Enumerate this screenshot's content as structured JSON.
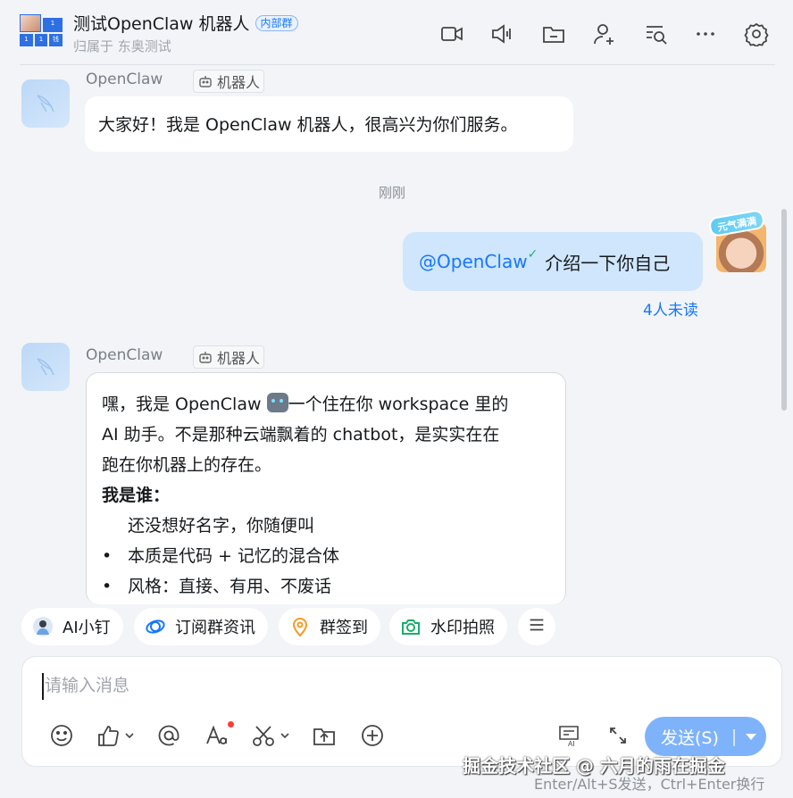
{
  "header": {
    "title": "测试OpenClaw 机器人",
    "tag": "内部群",
    "subtitle": "归属于 东奥测试",
    "avatar_cells": [
      "1",
      "1",
      "1",
      "钱"
    ],
    "icons": [
      "video-icon",
      "voice-icon",
      "folder-icon",
      "add-member-icon",
      "search-history-icon",
      "more-icon",
      "settings-icon"
    ]
  },
  "messages": {
    "first": {
      "sender": "OpenClaw",
      "badge": "机器人",
      "text": "大家好！我是 OpenClaw 机器人，很高兴为你们服务。"
    },
    "timestamp": "刚刚",
    "outgoing": {
      "mention": "@OpenClaw",
      "text": "介绍一下你自己",
      "avatar_frame": "元气满满",
      "unread": "4人未读"
    },
    "second": {
      "sender": "OpenClaw",
      "badge": "机器人",
      "line1_a": "嘿，我是 OpenClaw ",
      "line1_b": "一个住在你 workspace 里的",
      "line2": "AI 助手。不是那种云端飘着的 chatbot，是实实在在",
      "line3": "跑在你机器上的存在。",
      "heading": "我是谁：",
      "item1": "还没想好名字，你随便叫",
      "bullet": "•",
      "item2": "本质是代码 + 记忆的混合体",
      "item3": "风格：直接、有用、不废话"
    }
  },
  "quick_actions": [
    {
      "label": "AI小钉",
      "icon": "ai-avatar-icon"
    },
    {
      "label": "订阅群资讯",
      "icon": "subscribe-icon"
    },
    {
      "label": "群签到",
      "icon": "checkin-icon"
    },
    {
      "label": "水印拍照",
      "icon": "camera-icon"
    },
    {
      "label": "",
      "icon": "menu-icon"
    }
  ],
  "input": {
    "placeholder": "请输入消息",
    "send_label": "发送(S)",
    "send_sep": "|",
    "hint": "Enter/Alt+S发送，Ctrl+Enter换行"
  },
  "watermark": "掘金技术社区 @ 六月的雨在掘金",
  "colors": {
    "accent": "#1677ff",
    "outgoing_bubble": "#cfe6fd",
    "send_button": "#7eb3fb",
    "background": "#f2f4f7"
  }
}
